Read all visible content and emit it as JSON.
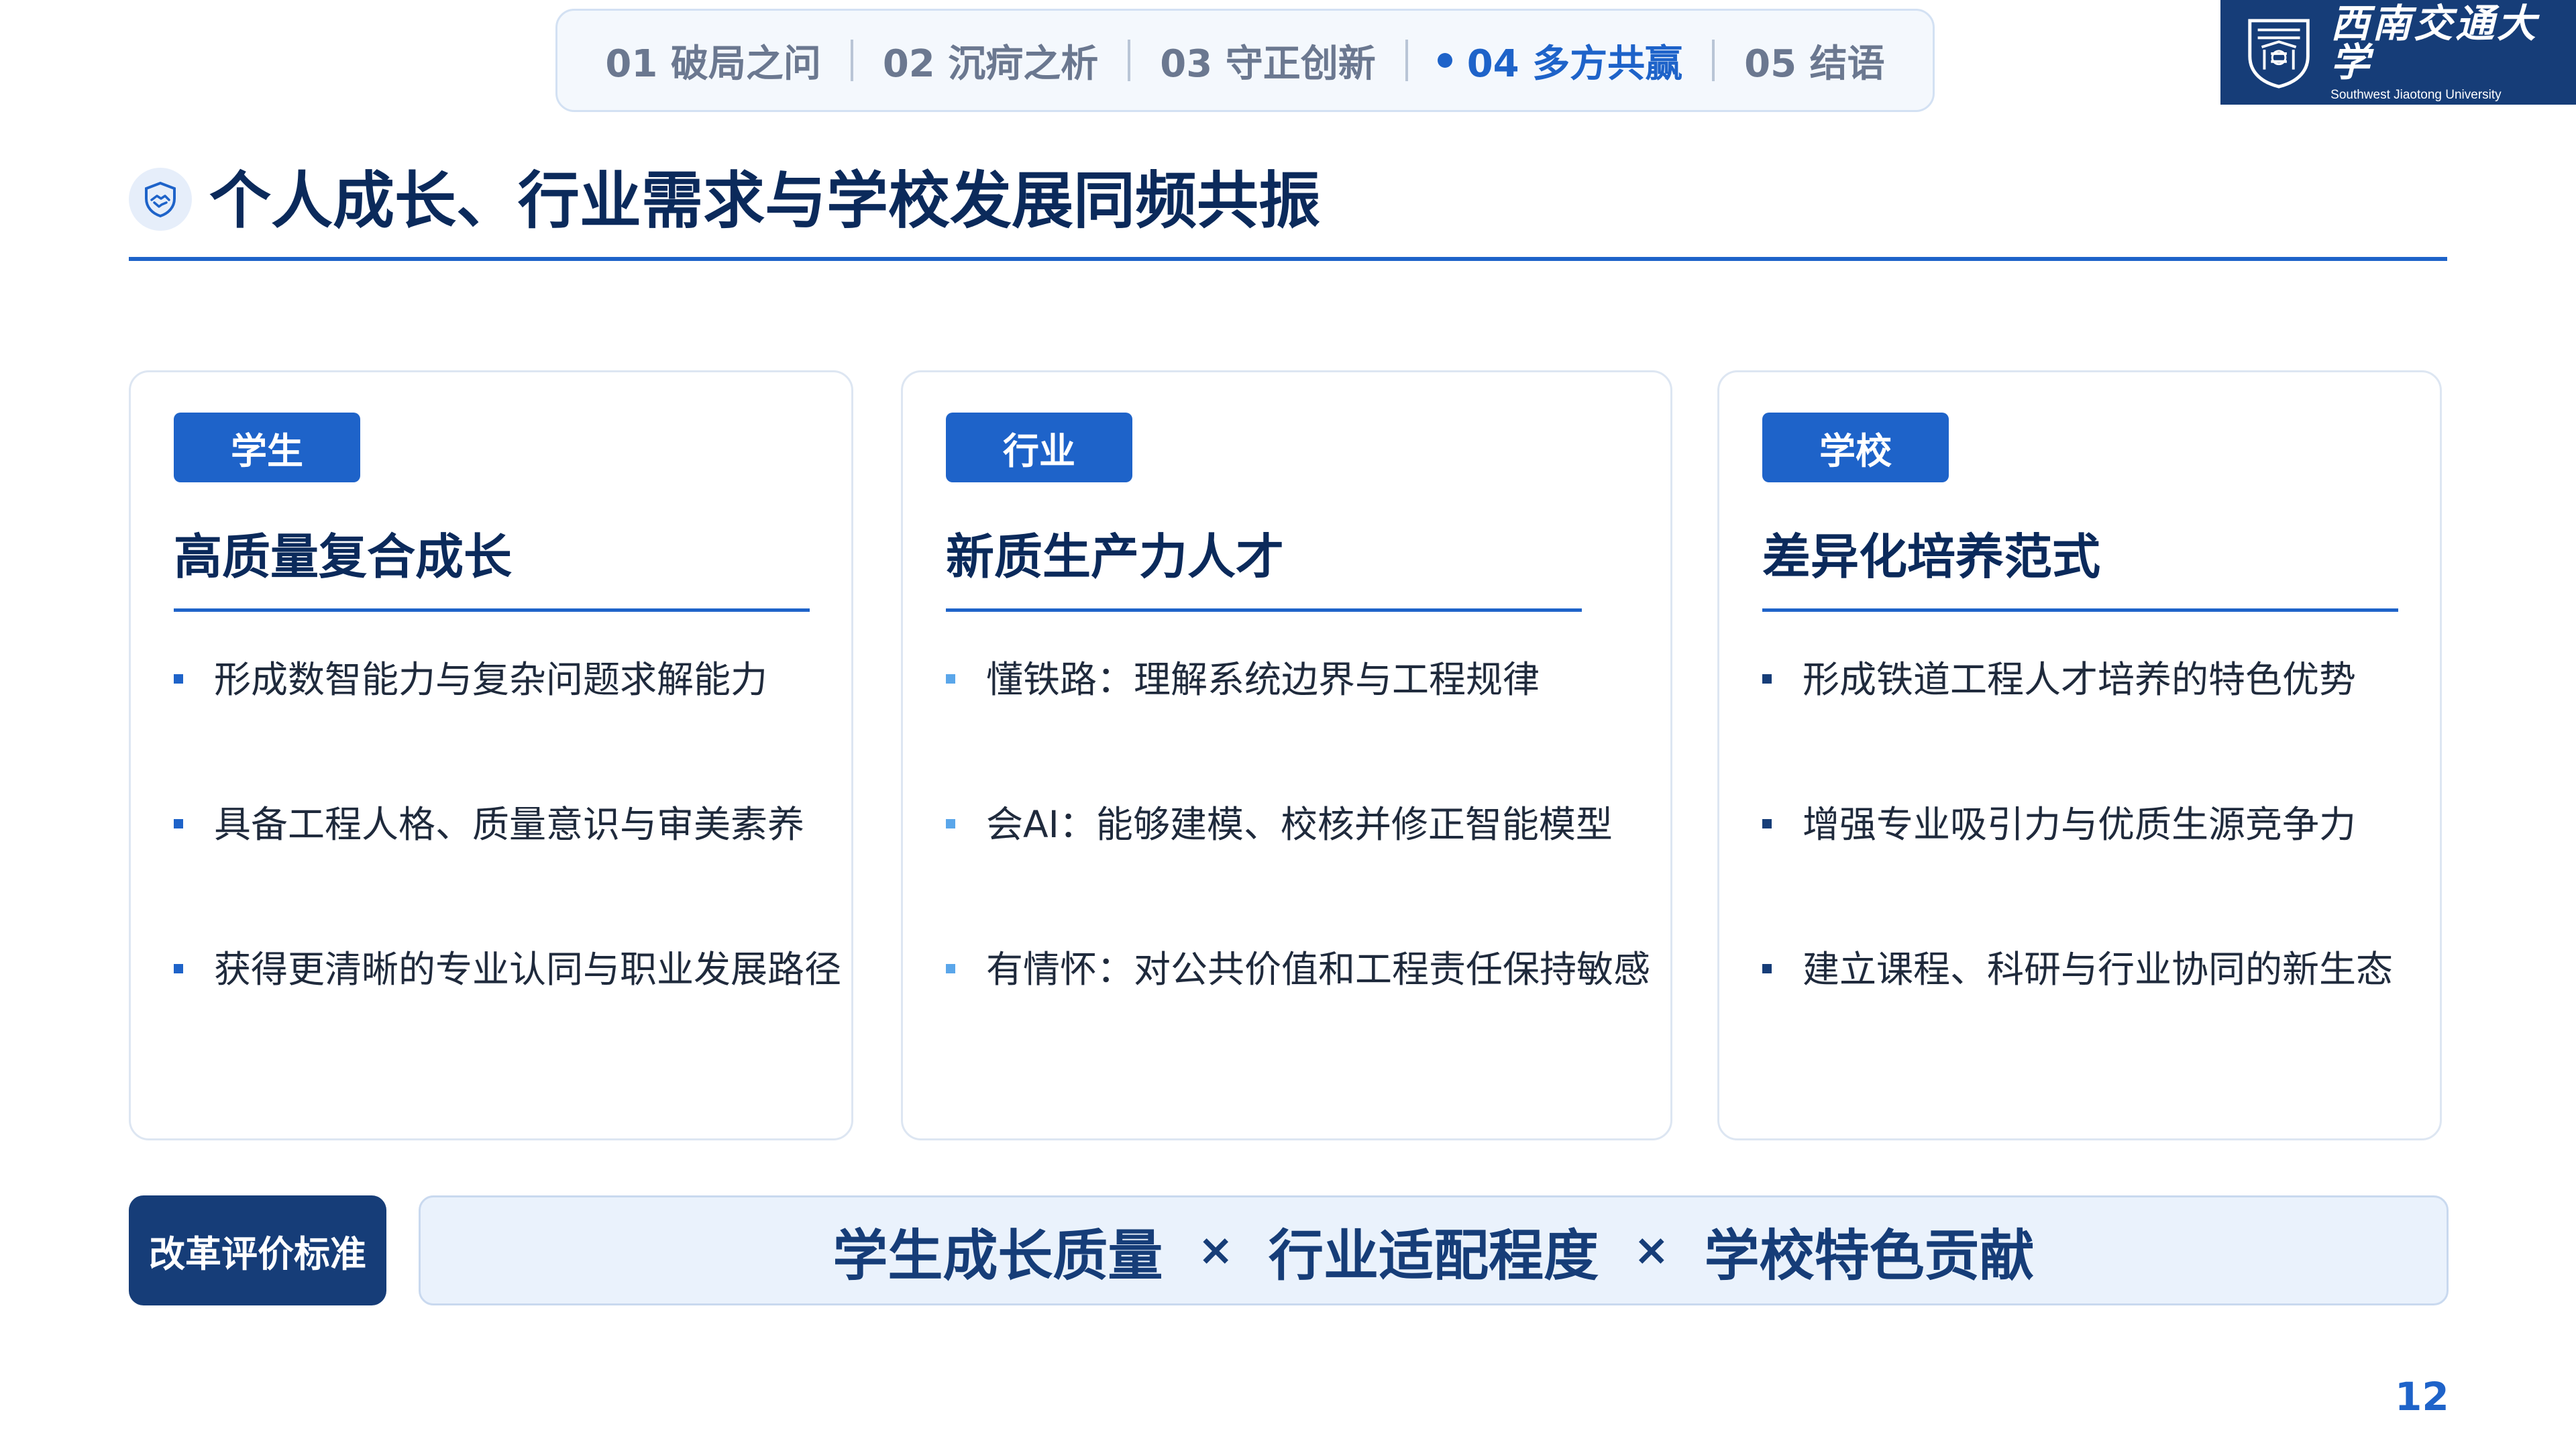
{
  "nav": {
    "items": [
      {
        "label": "01 破局之问",
        "active": false
      },
      {
        "label": "02 沉疴之析",
        "active": false
      },
      {
        "label": "03 守正创新",
        "active": false
      },
      {
        "label": "04 多方共赢",
        "active": true
      },
      {
        "label": "05 结语",
        "active": false
      }
    ]
  },
  "logo": {
    "name_cn": "西南交通大学",
    "name_en": "Southwest Jiaotong University"
  },
  "title": {
    "text": "个人成长、行业需求与学校发展同频共振",
    "icon": "handshake-shield-icon"
  },
  "cards": [
    {
      "badge": "学生",
      "heading": "高质量复合成长",
      "items": [
        "形成数智能力与复杂问题求解能力",
        "具备工程人格、质量意识与审美素养",
        "获得更清晰的专业认同与职业发展路径"
      ],
      "bullet_color": "#1e63c9"
    },
    {
      "badge": "行业",
      "heading": "新质生产力人才",
      "items": [
        "懂铁路：理解系统边界与工程规律",
        "会AI：能够建模、校核并修正智能模型",
        "有情怀：对公共价值和工程责任保持敏感"
      ],
      "bullet_color": "#5aa6ea"
    },
    {
      "badge": "学校",
      "heading": "差异化培养范式",
      "items": [
        "形成铁道工程人才培养的特色优势",
        "增强专业吸引力与优质生源竞争力",
        "建立课程、科研与行业协同的新生态"
      ],
      "bullet_color": "#163d78"
    }
  ],
  "criteria": {
    "label": "改革评价标准",
    "terms": [
      "学生成长质量",
      "行业适配程度",
      "学校特色贡献"
    ],
    "operator": "×"
  },
  "page_number": "12",
  "colors": {
    "accent": "#1e63c9",
    "navy": "#163d78",
    "text": "#0b2a5b"
  }
}
